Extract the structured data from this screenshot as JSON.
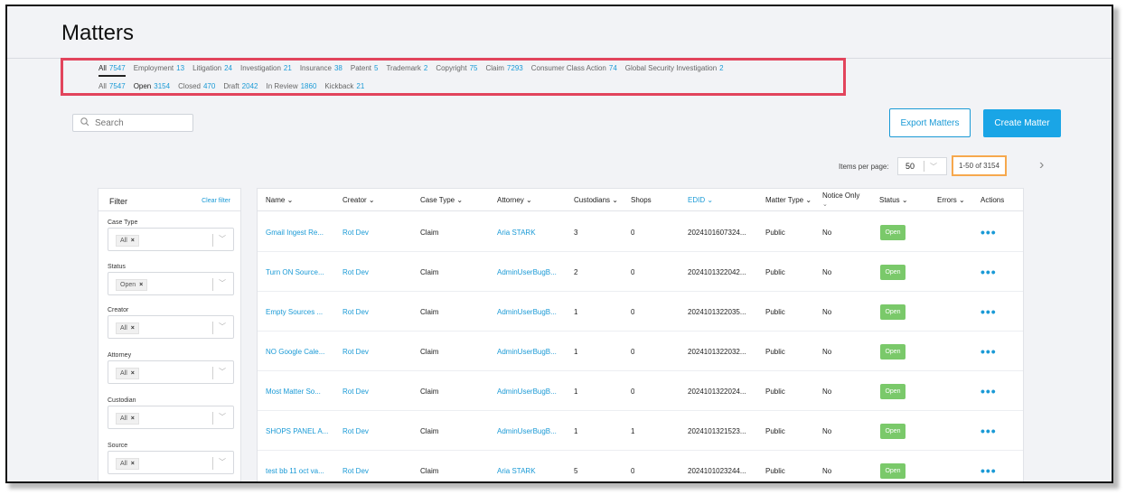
{
  "page": {
    "title": "Matters"
  },
  "case_type_tabs": [
    {
      "label": "All",
      "count": "7547"
    },
    {
      "label": "Employment",
      "count": "13"
    },
    {
      "label": "Litigation",
      "count": "24"
    },
    {
      "label": "Investigation",
      "count": "21"
    },
    {
      "label": "Insurance",
      "count": "38"
    },
    {
      "label": "Patent",
      "count": "5"
    },
    {
      "label": "Trademark",
      "count": "2"
    },
    {
      "label": "Copyright",
      "count": "75"
    },
    {
      "label": "Claim",
      "count": "7293"
    },
    {
      "label": "Consumer Class Action",
      "count": "74"
    },
    {
      "label": "Global Security Investigation",
      "count": "2"
    }
  ],
  "status_tabs": [
    {
      "label": "All",
      "count": "7547"
    },
    {
      "label": "Open",
      "count": "3154"
    },
    {
      "label": "Closed",
      "count": "470"
    },
    {
      "label": "Draft",
      "count": "2042"
    },
    {
      "label": "In Review",
      "count": "1860"
    },
    {
      "label": "Kickback",
      "count": "21"
    }
  ],
  "search": {
    "placeholder": "Search"
  },
  "buttons": {
    "export": "Export Matters",
    "create": "Create Matter"
  },
  "pagination": {
    "items_per_page_label": "Items per page:",
    "per_page_value": "50",
    "range": "1-50 of 3154"
  },
  "filter": {
    "title": "Filter",
    "clear": "Clear filter",
    "groups": [
      {
        "label": "Case Type",
        "chip": "All"
      },
      {
        "label": "Status",
        "chip": "Open"
      },
      {
        "label": "Creator",
        "chip": "All"
      },
      {
        "label": "Attorney",
        "chip": "All"
      },
      {
        "label": "Custodian",
        "chip": "All"
      },
      {
        "label": "Source",
        "chip": "All"
      }
    ]
  },
  "table": {
    "headers": {
      "name": "Name ⌄",
      "creator": "Creator ⌄",
      "case_type": "Case Type ⌄",
      "attorney": "Attorney ⌄",
      "custodians": "Custodians ⌄",
      "shops": "Shops",
      "edid": "EDID ⌄",
      "matter_type": "Matter Type ⌄",
      "notice_only": "Notice Only",
      "status": "Status ⌄",
      "errors": "Errors ⌄",
      "actions": "Actions"
    },
    "rows": [
      {
        "name": "Gmail Ingest Re...",
        "creator": "Rot Dev",
        "case_type": "Claim",
        "attorney": "Aria STARK",
        "custodians": "3",
        "shops": "0",
        "edid": "2024101607324...",
        "matter_type": "Public",
        "notice_only": "No",
        "status": "Open"
      },
      {
        "name": "Turn ON Source...",
        "creator": "Rot Dev",
        "case_type": "Claim",
        "attorney": "AdminUserBugB...",
        "custodians": "2",
        "shops": "0",
        "edid": "2024101322042...",
        "matter_type": "Public",
        "notice_only": "No",
        "status": "Open"
      },
      {
        "name": "Empty Sources ...",
        "creator": "Rot Dev",
        "case_type": "Claim",
        "attorney": "AdminUserBugB...",
        "custodians": "1",
        "shops": "0",
        "edid": "2024101322035...",
        "matter_type": "Public",
        "notice_only": "No",
        "status": "Open"
      },
      {
        "name": "NO Google Cale...",
        "creator": "Rot Dev",
        "case_type": "Claim",
        "attorney": "AdminUserBugB...",
        "custodians": "1",
        "shops": "0",
        "edid": "2024101322032...",
        "matter_type": "Public",
        "notice_only": "No",
        "status": "Open"
      },
      {
        "name": "Most Matter So...",
        "creator": "Rot Dev",
        "case_type": "Claim",
        "attorney": "AdminUserBugB...",
        "custodians": "1",
        "shops": "0",
        "edid": "2024101322024...",
        "matter_type": "Public",
        "notice_only": "No",
        "status": "Open"
      },
      {
        "name": "SHOPS PANEL A...",
        "creator": "Rot Dev",
        "case_type": "Claim",
        "attorney": "AdminUserBugB...",
        "custodians": "1",
        "shops": "1",
        "edid": "2024101321523...",
        "matter_type": "Public",
        "notice_only": "No",
        "status": "Open"
      },
      {
        "name": "test bb 11 oct va...",
        "creator": "Rot Dev",
        "case_type": "Claim",
        "attorney": "Aria STARK",
        "custodians": "5",
        "shops": "0",
        "edid": "2024101023244...",
        "matter_type": "Public",
        "notice_only": "No",
        "status": "Open"
      }
    ]
  },
  "colors": {
    "accent": "#1a9ad6",
    "status_open": "#7ac96a",
    "highlight_red": "#e2445c",
    "highlight_orange": "#f6a84d"
  }
}
